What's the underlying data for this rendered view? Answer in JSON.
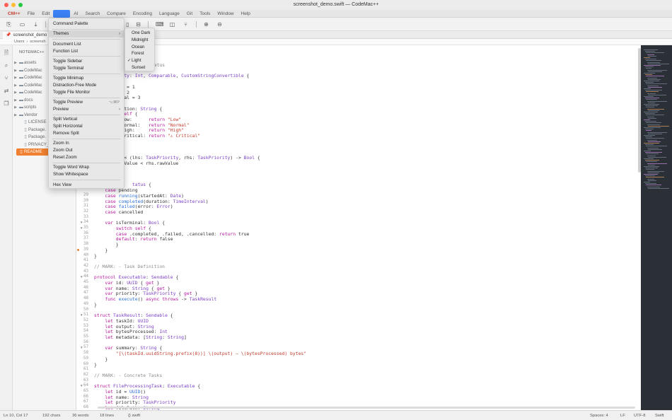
{
  "window": {
    "title": "screenshot_demo.swift — CodeMac++"
  },
  "menubar": {
    "items": [
      "CM++",
      "File",
      "Edit",
      "View",
      "AI",
      "Search",
      "Compare",
      "Encoding",
      "Language",
      "Git",
      "Tools",
      "Window",
      "Help"
    ]
  },
  "tab": {
    "label": "screenshot_demo"
  },
  "breadcrumb": {
    "parts": [
      "Users",
      "›",
      "screensh"
    ]
  },
  "sidebar": {
    "title": "NOTEMAC++",
    "items": [
      {
        "label": "assets",
        "kind": "folder"
      },
      {
        "label": "CodeMac",
        "kind": "folder"
      },
      {
        "label": "CodeMac",
        "kind": "folder"
      },
      {
        "label": "CodeMac",
        "kind": "folder"
      },
      {
        "label": "CodeMac",
        "kind": "folder"
      },
      {
        "label": "docs",
        "kind": "folder"
      },
      {
        "label": "scripts",
        "kind": "folder"
      },
      {
        "label": "Vendor",
        "kind": "folder"
      },
      {
        "label": "LICENSE",
        "kind": "file"
      },
      {
        "label": "Package.",
        "kind": "file"
      },
      {
        "label": "Package.",
        "kind": "file"
      },
      {
        "label": "PRIVACY_",
        "kind": "file"
      },
      {
        "label": "README",
        "kind": "file",
        "selected": true
      }
    ]
  },
  "view_menu": {
    "items": [
      {
        "label": "Command Palette"
      },
      {
        "sep": true
      },
      {
        "label": "Themes",
        "submenu": true,
        "highlighted": true
      },
      {
        "sep": true
      },
      {
        "label": "Document List"
      },
      {
        "label": "Function List"
      },
      {
        "sep": true
      },
      {
        "label": "Toggle Sidebar"
      },
      {
        "label": "Toggle Terminal"
      },
      {
        "sep": true
      },
      {
        "label": "Toggle Minimap"
      },
      {
        "label": "Distraction-Free Mode"
      },
      {
        "label": "Toggle File Monitor"
      },
      {
        "sep": true
      },
      {
        "label": "Toggle Preview",
        "shortcut": "⌥⌘P"
      },
      {
        "label": "Preview",
        "submenu": true
      },
      {
        "sep": true
      },
      {
        "label": "Split Vertical"
      },
      {
        "label": "Split Horizontal"
      },
      {
        "label": "Remove Split"
      },
      {
        "sep": true
      },
      {
        "label": "Zoom In"
      },
      {
        "label": "Zoom Out"
      },
      {
        "label": "Reset Zoom"
      },
      {
        "sep": true
      },
      {
        "label": "Toggle Word Wrap"
      },
      {
        "label": "Show Whitespace"
      },
      {
        "sep": true
      },
      {
        "label": "Hex View"
      }
    ]
  },
  "themes_menu": {
    "items": [
      {
        "label": "One Dark"
      },
      {
        "label": "Midnight"
      },
      {
        "label": "Ocean"
      },
      {
        "label": "Forest"
      },
      {
        "label": "Light",
        "checked": true
      },
      {
        "label": "Sunset"
      }
    ]
  },
  "editor": {
    "lines": [
      {
        "n": "",
        "html": "<span class=\"c\">ity &amp; Status</span>",
        "indent": 14
      },
      {
        "n": "",
        "html": ""
      },
      {
        "n": "",
        "html": "<span class=\"t\">riority</span>: <span class=\"t\">Int</span>, <span class=\"t\">Comparable</span>, <span class=\"t\">CustomStringConvertible</span> {",
        "indent": 6
      },
      {
        "n": "",
        "html": "w = 0",
        "indent": 6
      },
      {
        "n": "",
        "html": "ormal = 1",
        "indent": 6
      },
      {
        "n": "",
        "html": "igh = 2",
        "indent": 6
      },
      {
        "n": "",
        "html": "ritical = 3",
        "indent": 6
      },
      {
        "n": "",
        "html": ""
      },
      {
        "n": "",
        "html": "scription: <span class=\"t\">String</span> {",
        "indent": 6
      },
      {
        "n": "",
        "html": "<span class=\"k\">tch self</span> {",
        "indent": 6
      },
      {
        "n": "",
        "html": "<span class=\"k\">se</span> .low:      <span class=\"k\">return</span> <span class=\"s\">\"Low\"</span>",
        "indent": 6
      },
      {
        "n": "",
        "html": "<span class=\"k\">se</span> .normal:   <span class=\"k\">return</span> <span class=\"s\">\"Normal\"</span>",
        "indent": 6
      },
      {
        "n": "",
        "html": "<span class=\"k\">se</span> .high:     <span class=\"k\">return</span> <span class=\"s\">\"High\"</span>",
        "indent": 6
      },
      {
        "n": "",
        "html": "<span class=\"k\">se</span> .critical: <span class=\"k\">return</span> <span class=\"s\">\"⚠ Critical\"</span>",
        "indent": 6
      },
      {
        "n": "",
        "html": ""
      },
      {
        "n": "",
        "html": ""
      },
      {
        "n": "",
        "html": ""
      },
      {
        "n": "",
        "html": "<span class=\"k\">func</span> &lt; (lhs: <span class=\"t\">TaskPriority</span>, rhs: <span class=\"t\">TaskPriority</span>) -&gt; <span class=\"t\">Bool</span> {",
        "indent": 6
      },
      {
        "n": "",
        "html": "s.rawValue &lt; rhs.rawValue",
        "indent": 6
      },
      {
        "n": "",
        "html": ""
      },
      {
        "n": "",
        "html": ""
      },
      {
        "n": "",
        "html": ""
      },
      {
        "n": "",
        "html": "<span class=\"t\">tatus</span> {",
        "indent": 14
      },
      {
        "n": "",
        "html": "    <span class=\"k\">case</span> pending"
      },
      {
        "n": "29",
        "html": "    <span class=\"k\">case</span> <span class=\"f\">running</span>(startedAt: <span class=\"t\">Date</span>)"
      },
      {
        "n": "30",
        "html": "    <span class=\"k\">case</span> <span class=\"f\">completed</span>(duration: <span class=\"t\">TimeInterval</span>)"
      },
      {
        "n": "31",
        "html": "    <span class=\"k\">case</span> <span class=\"f\">failed</span>(error: <span class=\"t\">Error</span>)"
      },
      {
        "n": "32",
        "html": "    <span class=\"k\">case</span> cancelled"
      },
      {
        "n": "33",
        "html": ""
      },
      {
        "n": "34",
        "html": "    <span class=\"k\">var</span> isTerminal: <span class=\"t\">Bool</span> {",
        "fold": true
      },
      {
        "n": "35",
        "html": "        <span class=\"k\">switch self</span> {",
        "fold": true
      },
      {
        "n": "36",
        "html": "        <span class=\"k\">case</span> .completed, .failed, .cancelled: <span class=\"k\">return</span> true"
      },
      {
        "n": "37",
        "html": "        <span class=\"k\">default</span>: <span class=\"k\">return</span> false"
      },
      {
        "n": "38",
        "html": "        }"
      },
      {
        "n": "39",
        "html": "    }",
        "bp": true
      },
      {
        "n": "40",
        "html": "}"
      },
      {
        "n": "41",
        "html": ""
      },
      {
        "n": "42",
        "html": "<span class=\"c\">// MARK: - Task Definition</span>"
      },
      {
        "n": "43",
        "html": ""
      },
      {
        "n": "44",
        "html": "<span class=\"k\">protocol</span> <span class=\"t\">Executable</span>: <span class=\"t\">Sendable</span> {",
        "fold": true
      },
      {
        "n": "45",
        "html": "    <span class=\"k\">var</span> id: <span class=\"t\">UUID</span> { <span class=\"k\">get</span> }"
      },
      {
        "n": "46",
        "html": "    <span class=\"k\">var</span> name: <span class=\"t\">String</span> { <span class=\"k\">get</span> }"
      },
      {
        "n": "47",
        "html": "    <span class=\"k\">var</span> priority: <span class=\"t\">TaskPriority</span> { <span class=\"k\">get</span> }"
      },
      {
        "n": "48",
        "html": "    <span class=\"k\">func</span> <span class=\"f\">execute</span>() <span class=\"k\">async throws</span> -&gt; <span class=\"t\">TaskResult</span>"
      },
      {
        "n": "49",
        "html": "}"
      },
      {
        "n": "50",
        "html": ""
      },
      {
        "n": "51",
        "html": "<span class=\"k\">struct</span> <span class=\"t\">TaskResult</span>: <span class=\"t\">Sendable</span> {",
        "fold": true
      },
      {
        "n": "52",
        "html": "    <span class=\"k\">let</span> taskId: <span class=\"t\">UUID</span>"
      },
      {
        "n": "53",
        "html": "    <span class=\"k\">let</span> output: <span class=\"t\">String</span>"
      },
      {
        "n": "54",
        "html": "    <span class=\"k\">let</span> bytesProcessed: <span class=\"t\">Int</span>"
      },
      {
        "n": "55",
        "html": "    <span class=\"k\">let</span> metadata: [<span class=\"t\">String</span>: <span class=\"t\">String</span>]"
      },
      {
        "n": "56",
        "html": ""
      },
      {
        "n": "57",
        "html": "    <span class=\"k\">var</span> summary: <span class=\"t\">String</span> {",
        "fold": true
      },
      {
        "n": "58",
        "html": "        <span class=\"s\">\"[\\(taskId.uuidString.prefix(8))] \\(output) — \\(bytesProcessed) bytes\"</span>"
      },
      {
        "n": "59",
        "html": "    }"
      },
      {
        "n": "60",
        "html": "}"
      },
      {
        "n": "61",
        "html": ""
      },
      {
        "n": "62",
        "html": "<span class=\"c\">// MARK: - Concrete Tasks</span>"
      },
      {
        "n": "63",
        "html": ""
      },
      {
        "n": "64",
        "html": "<span class=\"k\">struct</span> <span class=\"t\">FileProcessingTask</span>: <span class=\"t\">Executable</span> {",
        "fold": true
      },
      {
        "n": "65",
        "html": "    <span class=\"k\">let</span> id = <span class=\"f\">UUID</span>()"
      },
      {
        "n": "66",
        "html": "    <span class=\"k\">let</span> name: <span class=\"t\">String</span>"
      },
      {
        "n": "67",
        "html": "    <span class=\"k\">let</span> priority: <span class=\"t\">TaskPriority</span>"
      },
      {
        "n": "68",
        "html": "    <span class=\"k\">let</span> filePath: <span class=\"t\">String</span>"
      }
    ]
  },
  "statusbar": {
    "position": "Ln 10, Col 17",
    "chars": "192 chars",
    "words": "36 words",
    "lines": "18 lines",
    "language": "{} swift",
    "spaces": "Spaces: 4",
    "eol": "LF",
    "encoding": "UTF-8",
    "lang_short": "Swift"
  },
  "colors": {
    "accent": "#3b82f6",
    "selection": "#f08030",
    "brand": "#c0392b",
    "light_red": "#ff5f57",
    "light_yellow": "#febc2e",
    "light_green": "#28c840"
  }
}
